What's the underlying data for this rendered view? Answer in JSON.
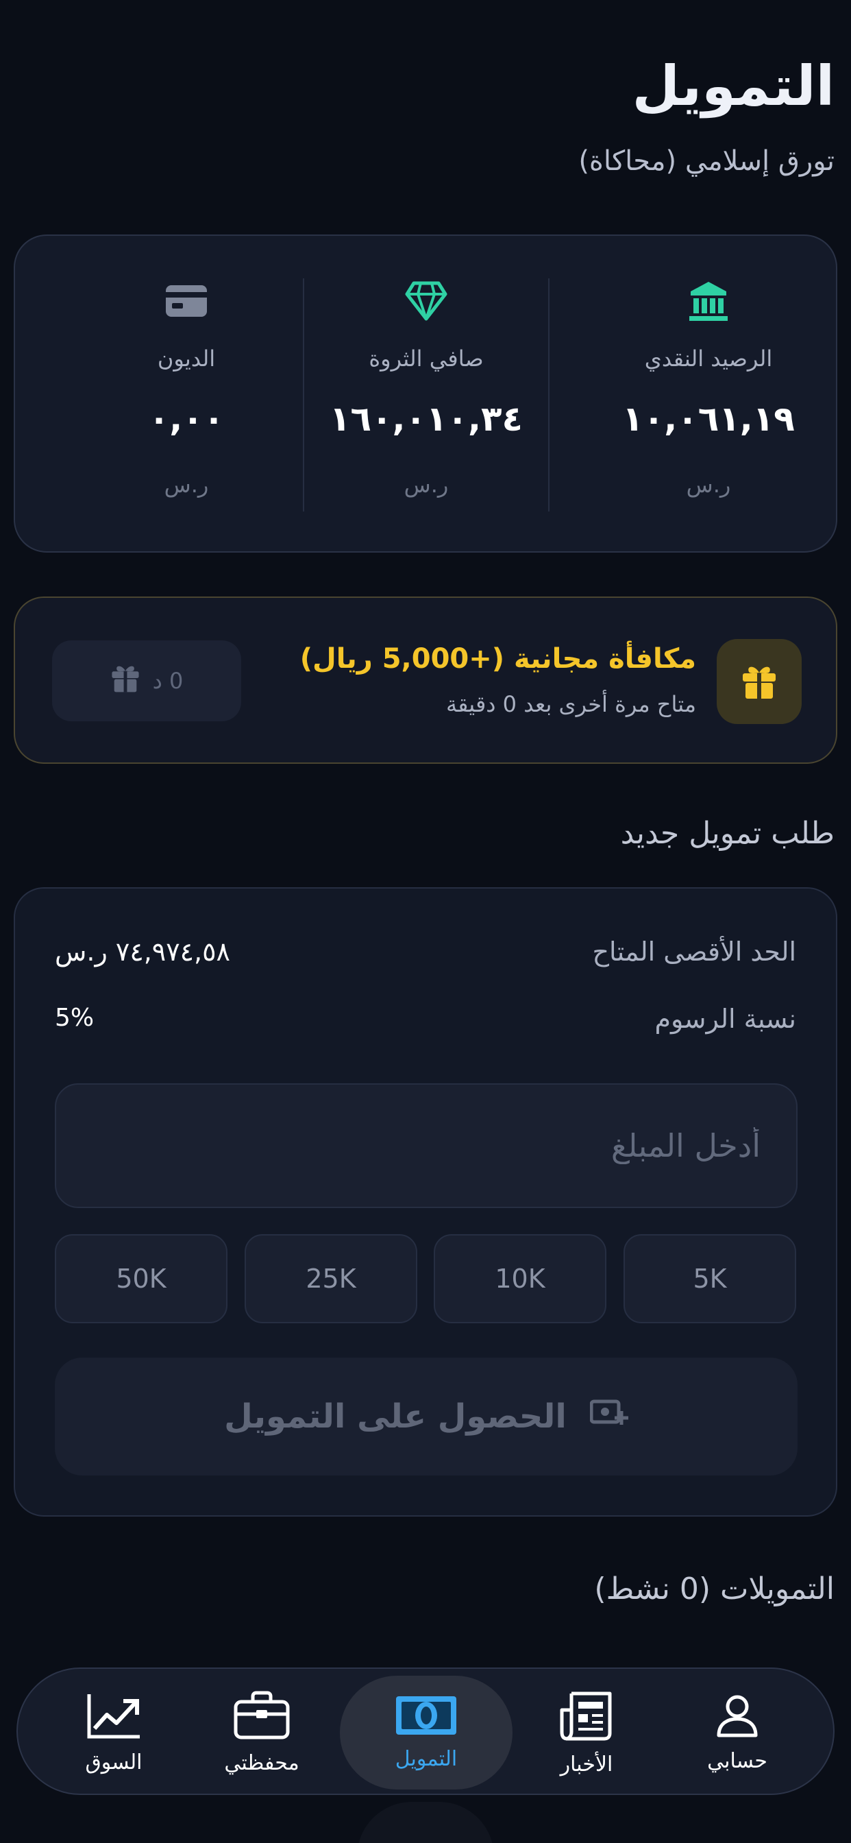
{
  "header": {
    "title": "التمويل",
    "subtitle": "تورق إسلامي (محاكاة)"
  },
  "summary": {
    "items": [
      {
        "label": "الرصيد النقدي",
        "value": "١٠,٠٦١,١٩",
        "currency": "ر.س",
        "icon": "bank-icon",
        "color": "#2fd1a4"
      },
      {
        "label": "صافي الثروة",
        "value": "١٦٠,٠١٠,٣٤",
        "currency": "ر.س",
        "icon": "diamond-icon",
        "color": "#2fd1a4"
      },
      {
        "label": "الديون",
        "value": "٠,٠٠",
        "currency": "ر.س",
        "icon": "credit-card-icon",
        "color": "#7e8699"
      }
    ]
  },
  "bonus": {
    "title": "مكافأة مجانية (+5,000 ريال)",
    "subtitle": "متاح مرة أخرى بعد 0 دقيقة",
    "claim_label": "0 د",
    "accent": "#f5c52a"
  },
  "new_finance": {
    "section_title": "طلب تمويل جديد",
    "max_label": "الحد الأقصى المتاح",
    "max_value": "٧٤,٩٧٤,٥٨ ر.س",
    "fee_label": "نسبة الرسوم",
    "fee_value": "5%",
    "amount_placeholder": "أدخل المبلغ",
    "chips": [
      "5K",
      "10K",
      "25K",
      "50K"
    ],
    "submit_label": "الحصول على التمويل"
  },
  "active_finances": {
    "section_title": "التمويلات (0 نشط)"
  },
  "nav": {
    "items": [
      {
        "label": "حسابي",
        "icon": "user-icon"
      },
      {
        "label": "الأخبار",
        "icon": "newspaper-icon"
      },
      {
        "label": "التمويل",
        "icon": "banknote-icon",
        "active": true
      },
      {
        "label": "محفظتي",
        "icon": "briefcase-icon"
      },
      {
        "label": "السوق",
        "icon": "trending-up-icon"
      }
    ],
    "active_color": "#3ba7f0"
  }
}
